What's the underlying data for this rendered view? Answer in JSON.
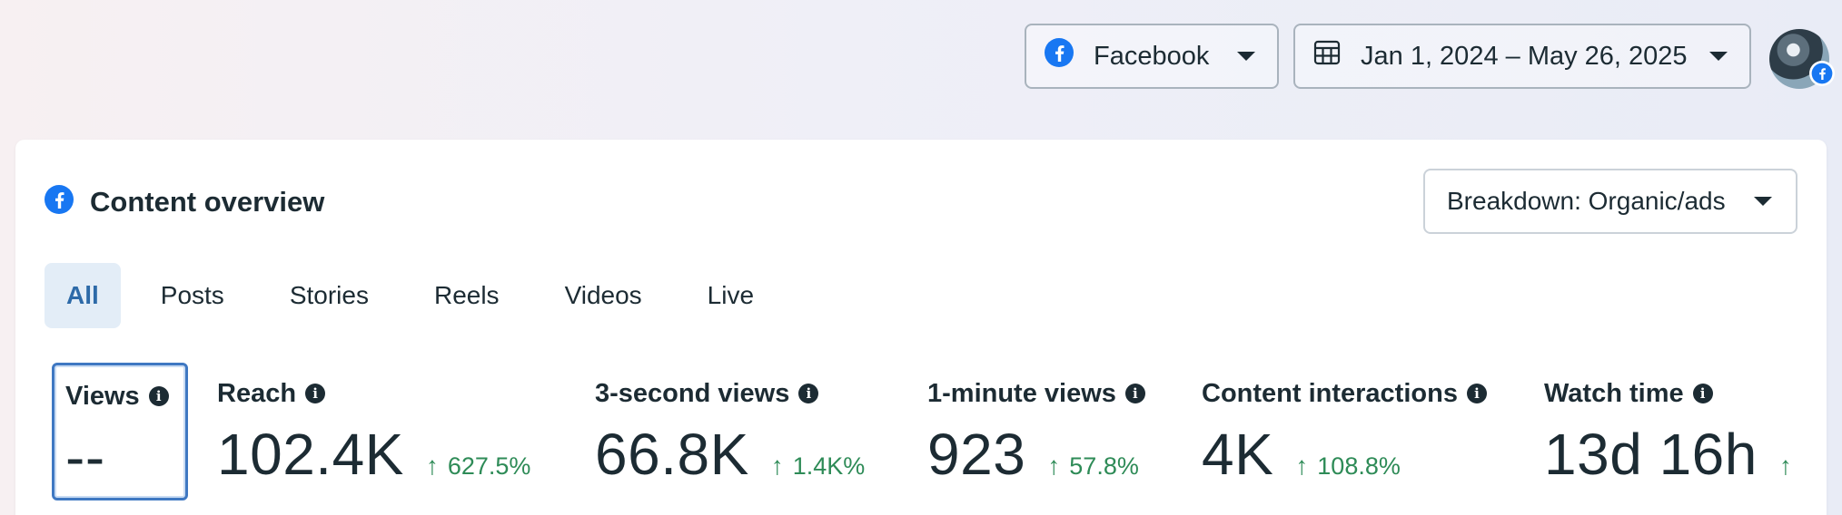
{
  "header": {
    "platform_label": "Facebook",
    "date_range_label": "Jan 1, 2024 – May 26, 2025"
  },
  "card": {
    "title": "Content overview",
    "breakdown_label": "Breakdown: Organic/ads",
    "tabs": [
      {
        "label": "All",
        "active": true
      },
      {
        "label": "Posts"
      },
      {
        "label": "Stories"
      },
      {
        "label": "Reels"
      },
      {
        "label": "Videos"
      },
      {
        "label": "Live"
      }
    ],
    "metrics": [
      {
        "label": "Views",
        "value": "--",
        "delta": ""
      },
      {
        "label": "Reach",
        "value": "102.4K",
        "delta": "627.5%"
      },
      {
        "label": "3-second views",
        "value": "66.8K",
        "delta": "1.4K%"
      },
      {
        "label": "1-minute views",
        "value": "923",
        "delta": "57.8%"
      },
      {
        "label": "Content interactions",
        "value": "4K",
        "delta": "108.8%"
      },
      {
        "label": "Watch time",
        "value": "13d 16h",
        "delta": ""
      }
    ]
  },
  "colors": {
    "brand_blue": "#1877f2",
    "positive_green": "#2e8b57",
    "active_tab_bg": "#e3edf7",
    "selected_border": "#3f78c2"
  },
  "icons": [
    "facebook-icon",
    "calendar-icon",
    "caret-down-icon",
    "info-icon",
    "arrow-up-icon"
  ]
}
